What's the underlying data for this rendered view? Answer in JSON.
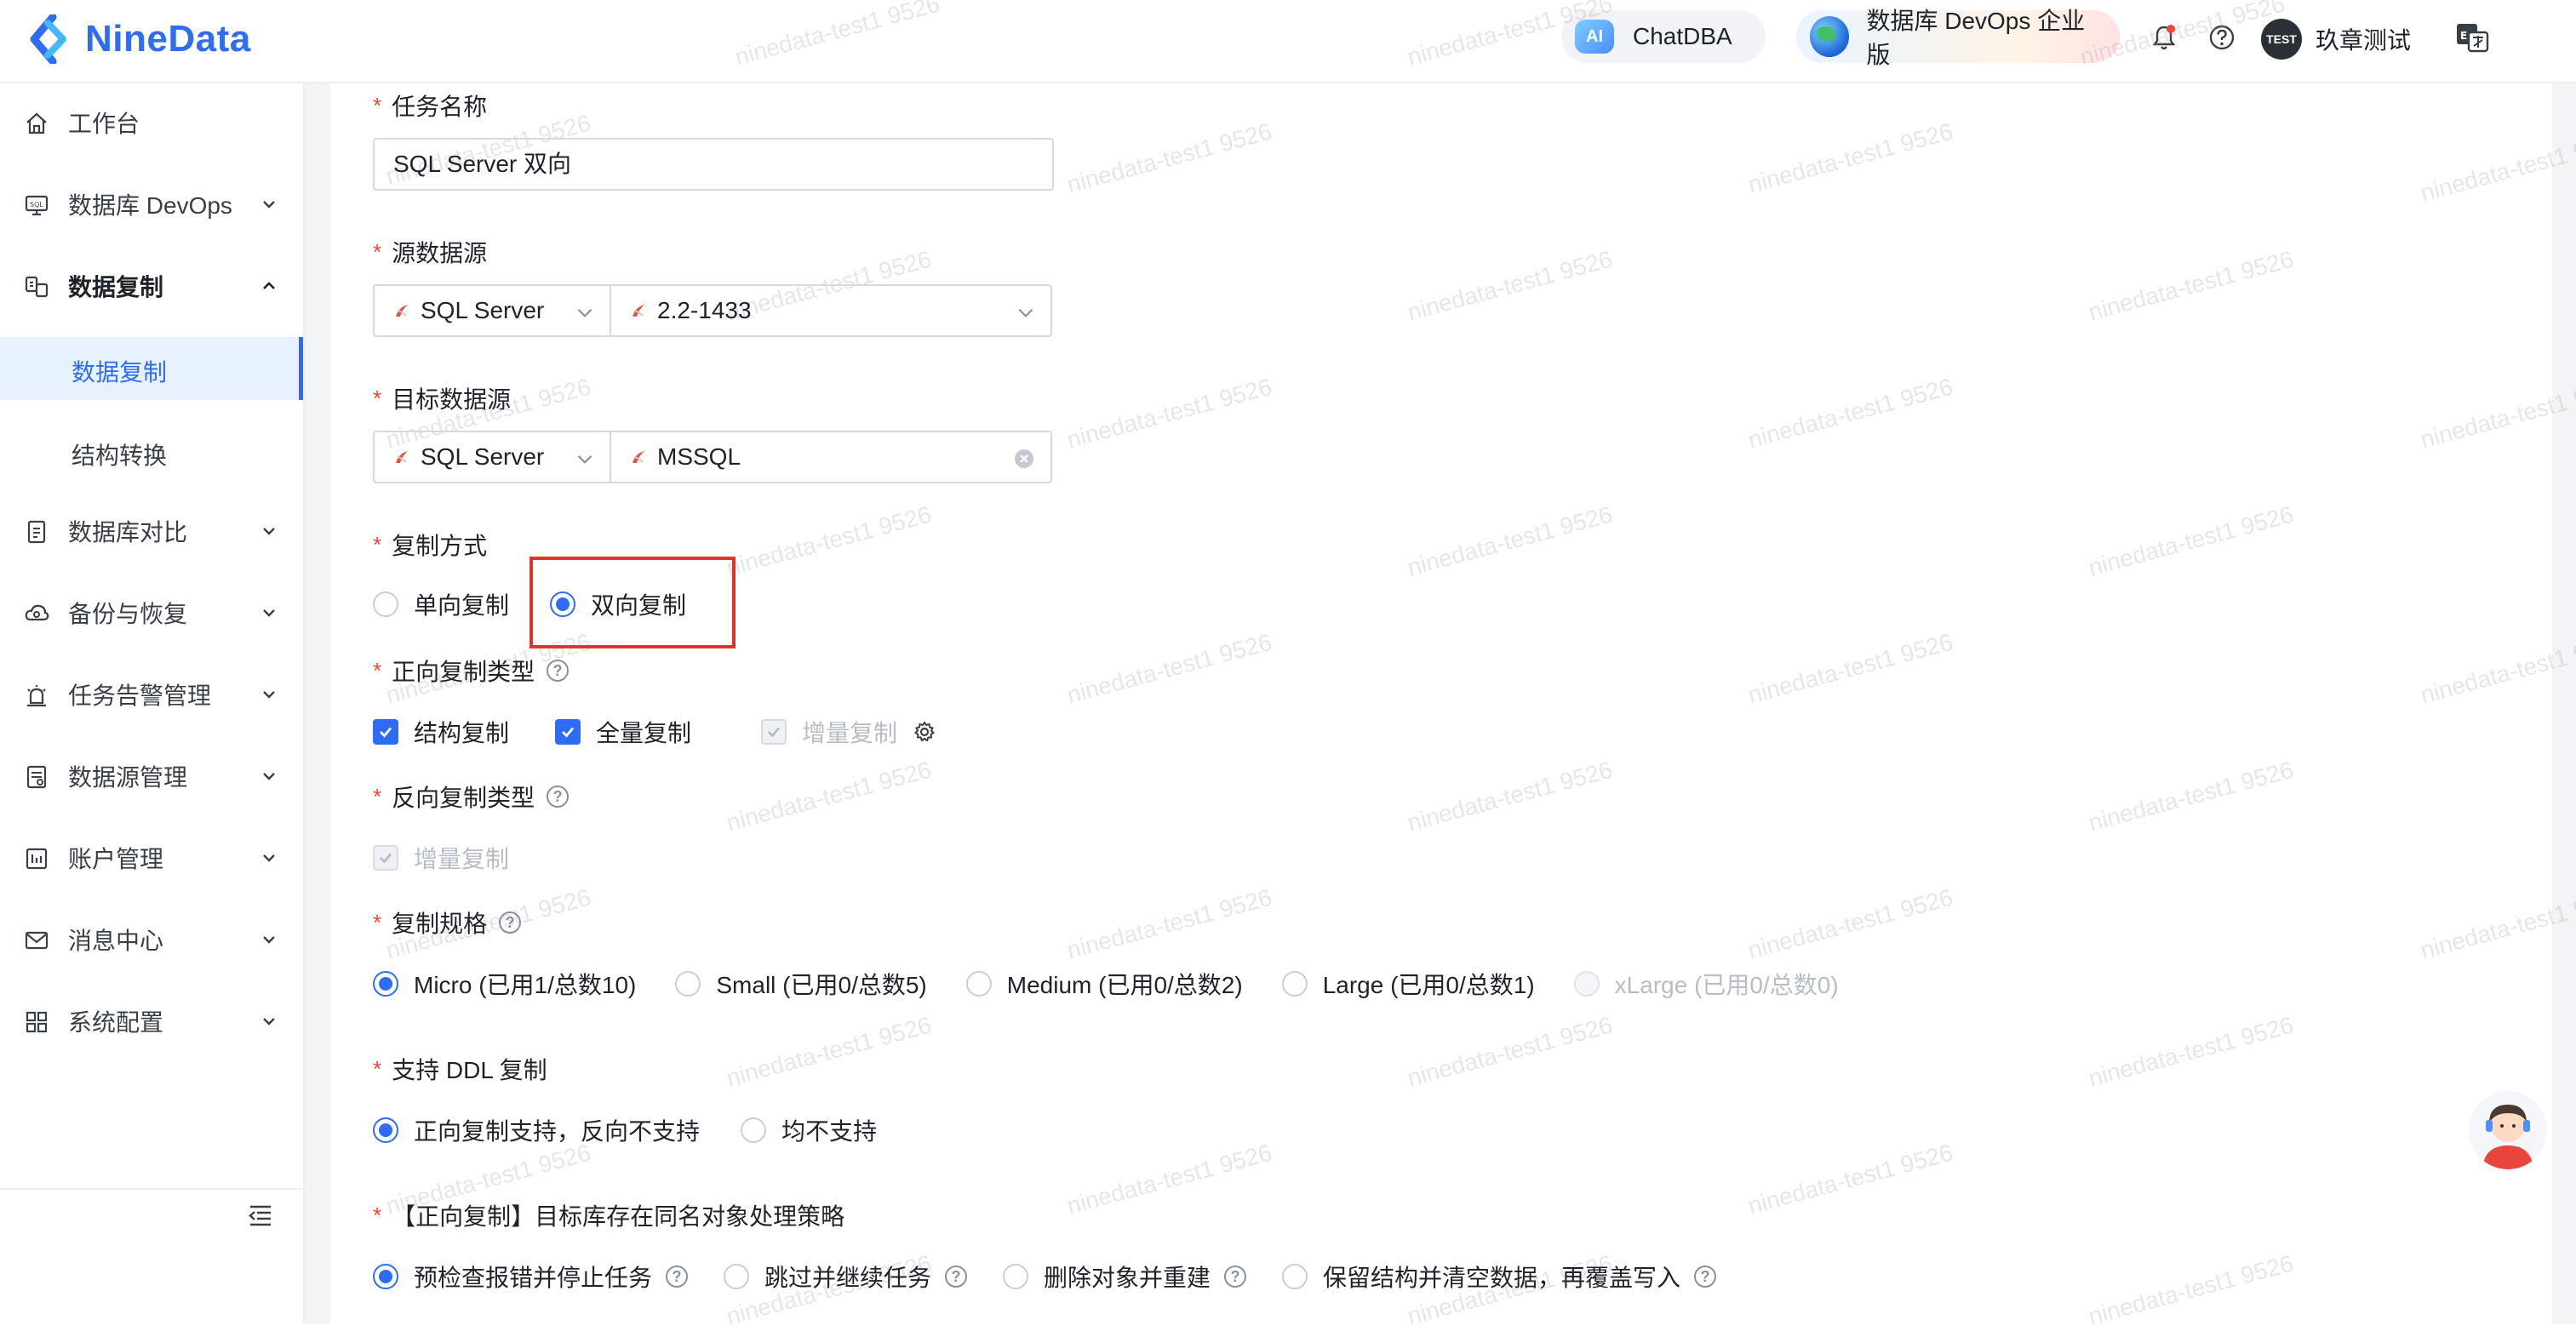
{
  "header": {
    "logo_text": "NineData",
    "chatdba_label": "ChatDBA",
    "ai_badge": "AI",
    "devops_label": "数据库 DevOps 企业版",
    "avatar_text": "TEST",
    "username": "玖章测试",
    "lang_badge": "En"
  },
  "sidebar": {
    "items": [
      {
        "label": "工作台",
        "icon": "home-icon"
      },
      {
        "label": "数据库 DevOps",
        "icon": "sql-monitor-icon"
      },
      {
        "label": "数据复制",
        "icon": "replication-icon"
      },
      {
        "label": "数据库对比",
        "icon": "compare-icon"
      },
      {
        "label": "备份与恢复",
        "icon": "cloud-backup-icon"
      },
      {
        "label": "任务告警管理",
        "icon": "alarm-icon"
      },
      {
        "label": "数据源管理",
        "icon": "datasource-icon"
      },
      {
        "label": "账户管理",
        "icon": "account-icon"
      },
      {
        "label": "消息中心",
        "icon": "mail-icon"
      },
      {
        "label": "系统配置",
        "icon": "grid-icon"
      }
    ],
    "sub_items": [
      {
        "label": "数据复制"
      },
      {
        "label": "结构转换"
      }
    ]
  },
  "form": {
    "task_name": {
      "label": "任务名称",
      "value": "SQL Server 双向"
    },
    "source": {
      "label": "源数据源",
      "type_value": "SQL Server",
      "instance_value": "2.2-1433"
    },
    "target": {
      "label": "目标数据源",
      "type_value": "SQL Server",
      "instance_value": "MSSQL"
    },
    "replication_mode": {
      "label": "复制方式",
      "options": [
        "单向复制",
        "双向复制"
      ],
      "selected": "双向复制"
    },
    "forward_type": {
      "label": "正向复制类型",
      "options": [
        "结构复制",
        "全量复制",
        "增量复制"
      ]
    },
    "reverse_type": {
      "label": "反向复制类型",
      "options": [
        "增量复制"
      ]
    },
    "spec": {
      "label": "复制规格",
      "options": [
        "Micro (已用1/总数10)",
        "Small (已用0/总数5)",
        "Medium (已用0/总数2)",
        "Large (已用0/总数1)",
        "xLarge (已用0/总数0)"
      ]
    },
    "ddl": {
      "label": "支持 DDL 复制",
      "options": [
        "正向复制支持，反向不支持",
        "均不支持"
      ]
    },
    "conflict": {
      "label": "【正向复制】目标库存在同名对象处理策略",
      "options": [
        "预检查报错并停止任务",
        "跳过并继续任务",
        "删除对象并重建",
        "保留结构并清空数据，再覆盖写入"
      ]
    }
  },
  "watermark_text": "ninedata-test1 9526",
  "colors": {
    "primary": "#2f6cf6",
    "required": "#f0453a",
    "highlight": "#e0352b"
  }
}
